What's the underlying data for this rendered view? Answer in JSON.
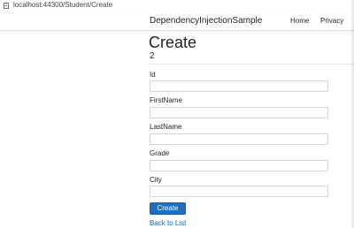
{
  "browser": {
    "url": "localhost:44300/Student/Create"
  },
  "navbar": {
    "brand": "DependencyInjectionSample",
    "links": [
      "Home",
      "Privacy"
    ]
  },
  "page": {
    "title": "Create",
    "subtitle": "2"
  },
  "form": {
    "fields": [
      {
        "label": "Id",
        "value": ""
      },
      {
        "label": "FirstName",
        "value": ""
      },
      {
        "label": "LastName",
        "value": ""
      },
      {
        "label": "Grade",
        "value": ""
      },
      {
        "label": "City",
        "value": ""
      }
    ],
    "submit_label": "Create",
    "back_link": "Back to List"
  },
  "colors": {
    "primary_button": "#1b6ec2",
    "link": "#0366d6"
  },
  "icons": {
    "address_bar": "page-icon"
  }
}
